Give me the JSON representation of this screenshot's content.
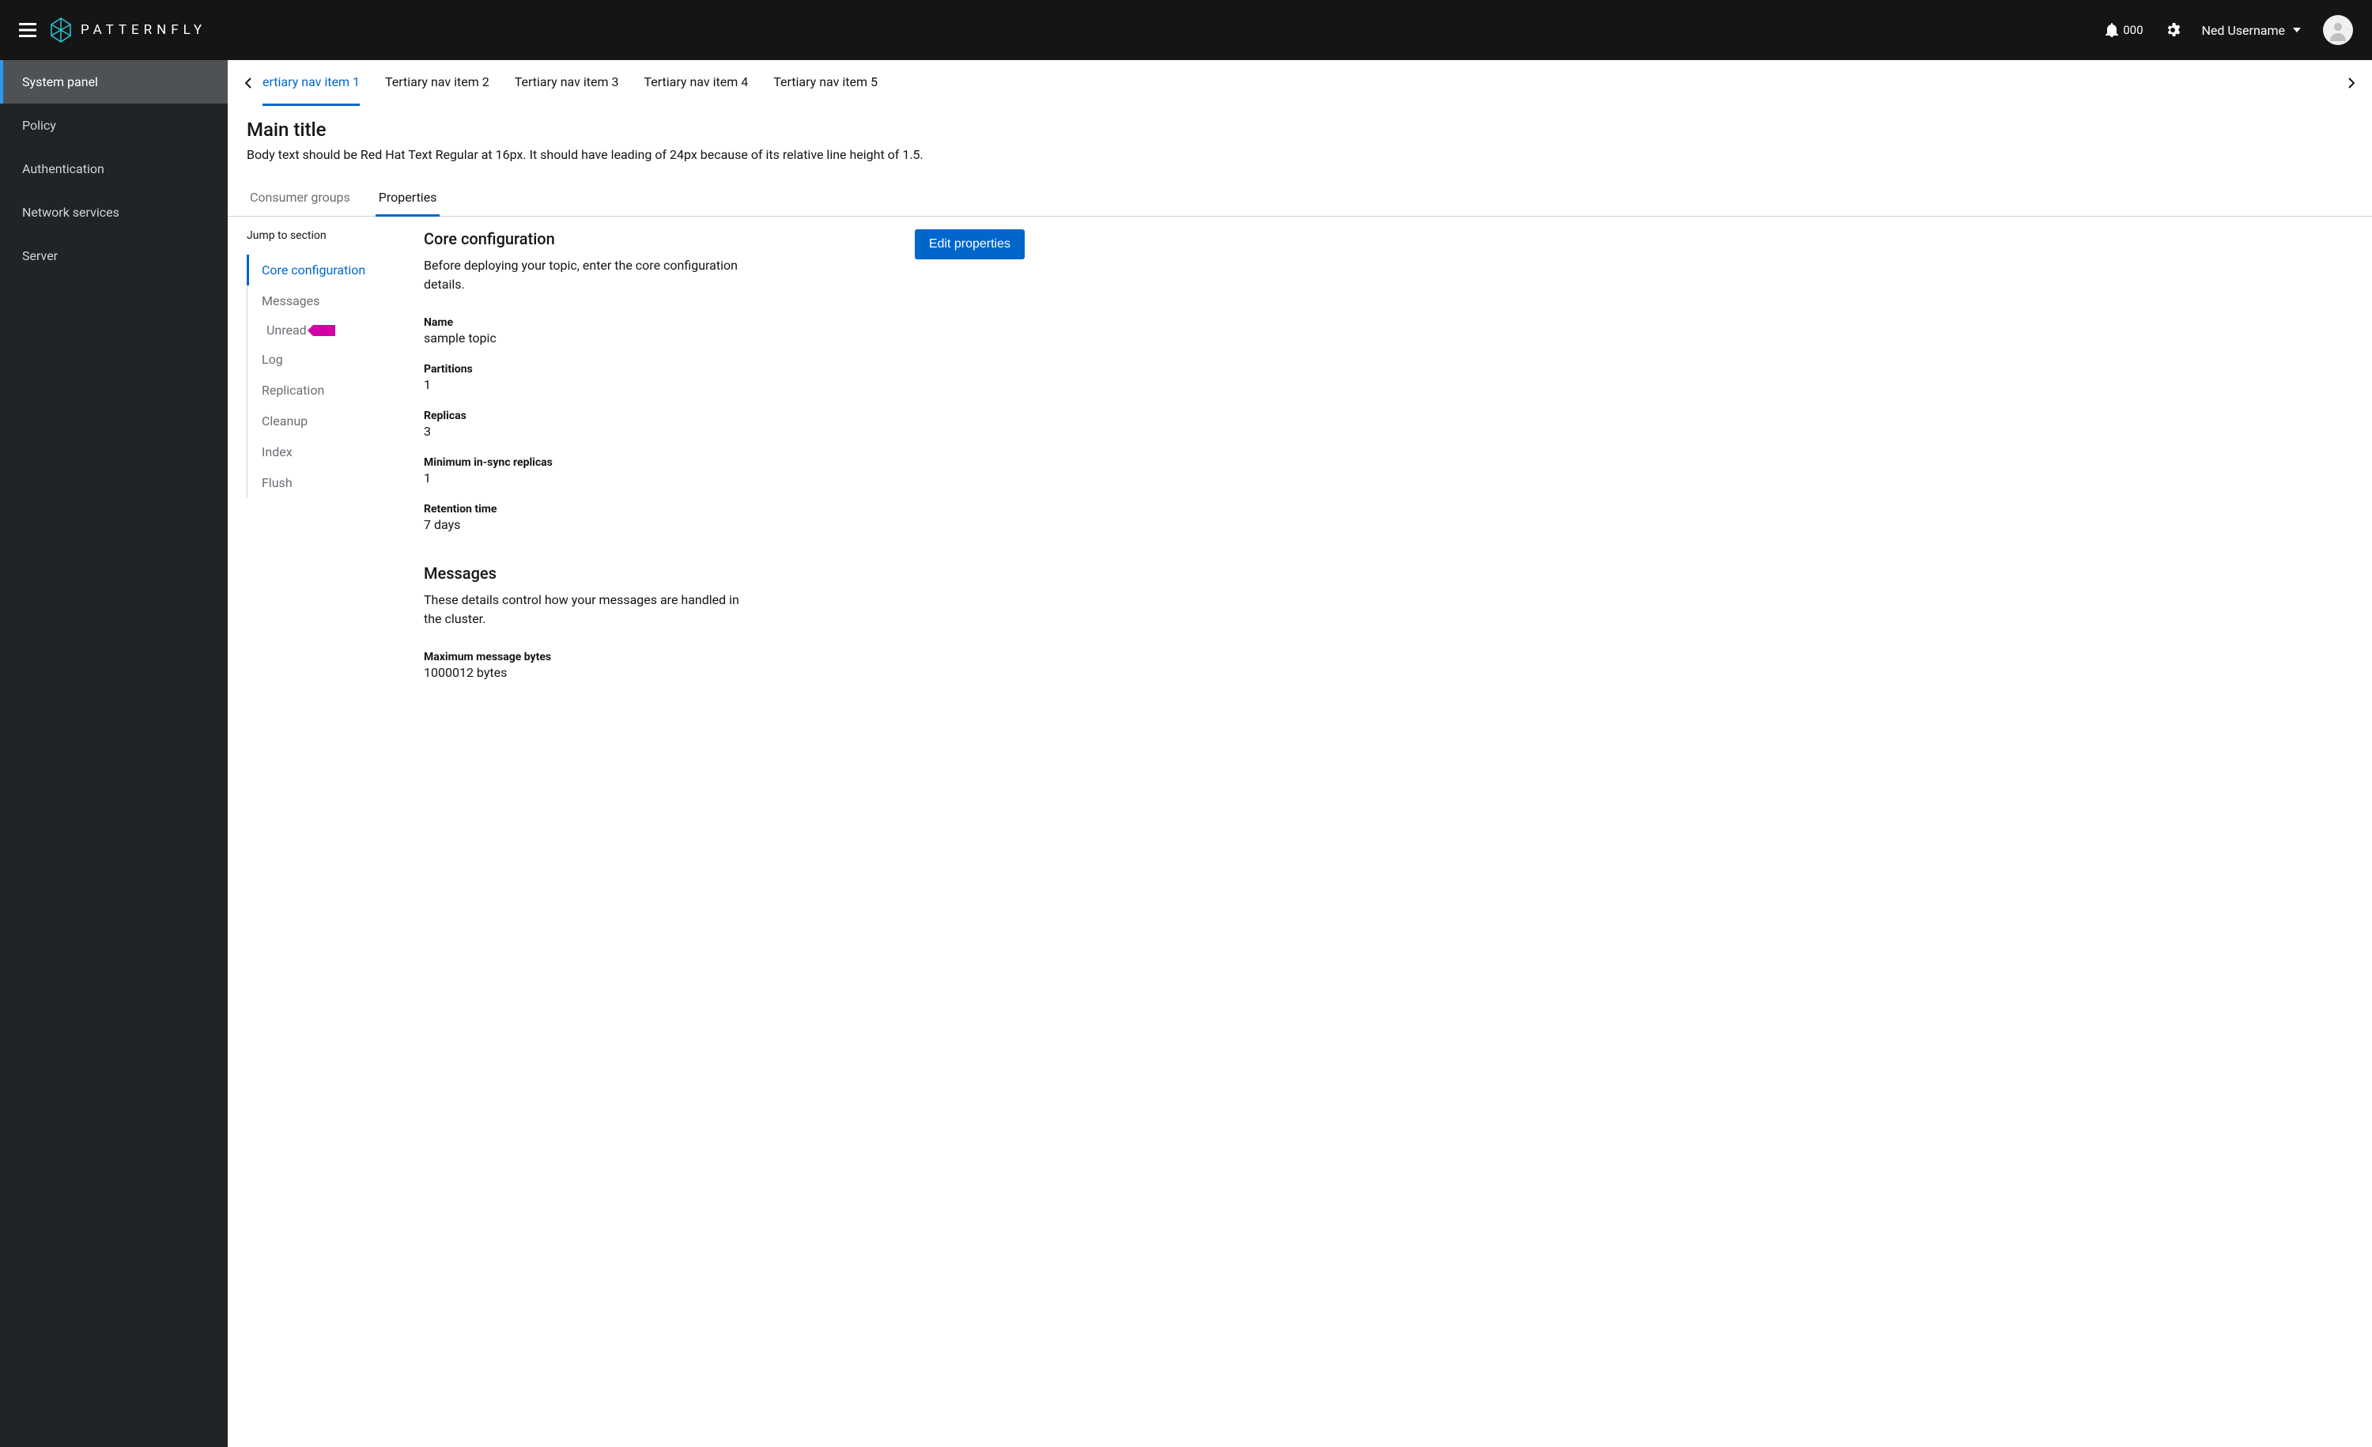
{
  "masthead": {
    "brand": "PATTERNFLY",
    "notification_count": "000",
    "username": "Ned Username"
  },
  "sidebar": {
    "items": [
      {
        "label": "System panel",
        "active": true
      },
      {
        "label": "Policy",
        "active": false
      },
      {
        "label": "Authentication",
        "active": false
      },
      {
        "label": "Network services",
        "active": false
      },
      {
        "label": "Server",
        "active": false
      }
    ]
  },
  "tertiary_nav": {
    "items": [
      {
        "label": "ertiary nav item 1",
        "active": true
      },
      {
        "label": "Tertiary nav item 2",
        "active": false
      },
      {
        "label": "Tertiary nav item 3",
        "active": false
      },
      {
        "label": "Tertiary nav item 4",
        "active": false
      },
      {
        "label": "Tertiary nav item 5",
        "active": false
      }
    ]
  },
  "page": {
    "title": "Main title",
    "body": "Body text should be Red Hat Text Regular at 16px. It should have leading of 24px because of its relative line height of 1.5."
  },
  "sub_tabs": [
    {
      "label": "Consumer groups",
      "active": false
    },
    {
      "label": "Properties",
      "active": true
    }
  ],
  "jump": {
    "title": "Jump to section",
    "items": [
      {
        "label": "Core configuration",
        "active": true
      },
      {
        "label": "Messages",
        "active": false,
        "sub": [
          {
            "label": "Unread"
          }
        ]
      },
      {
        "label": "Log",
        "active": false
      },
      {
        "label": "Replication",
        "active": false
      },
      {
        "label": "Cleanup",
        "active": false
      },
      {
        "label": "Index",
        "active": false
      },
      {
        "label": "Flush",
        "active": false
      }
    ]
  },
  "edit_button": "Edit properties",
  "sections": [
    {
      "title": "Core configuration",
      "desc": "Before deploying your topic, enter the core configuration details.",
      "props": [
        {
          "label": "Name",
          "value": "sample topic"
        },
        {
          "label": "Partitions",
          "value": "1"
        },
        {
          "label": "Replicas",
          "value": "3"
        },
        {
          "label": "Minimum in-sync replicas",
          "value": "1"
        },
        {
          "label": "Retention time",
          "value": "7 days"
        }
      ]
    },
    {
      "title": "Messages",
      "desc": "These details control how your messages are handled in the cluster.",
      "props": [
        {
          "label": "Maximum message bytes",
          "value": "1000012 bytes"
        }
      ]
    }
  ]
}
